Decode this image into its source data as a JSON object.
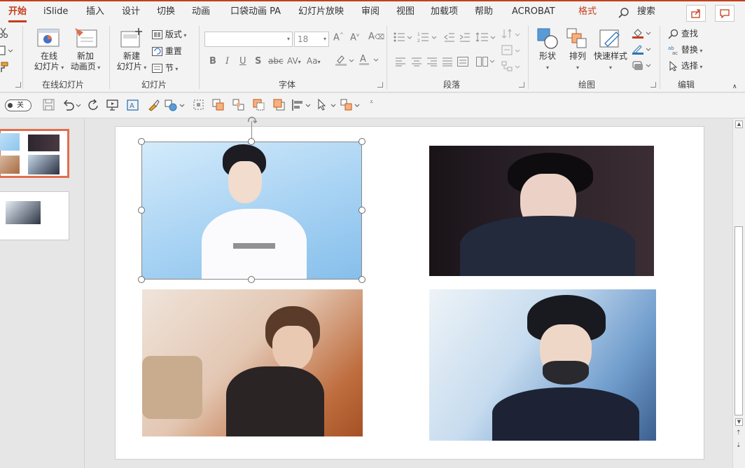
{
  "tabs": [
    {
      "label": "开始",
      "active": true
    },
    {
      "label": "iSlide"
    },
    {
      "label": "插入"
    },
    {
      "label": "设计"
    },
    {
      "label": "切换"
    },
    {
      "label": "动画"
    },
    {
      "label": "口袋动画 PA"
    },
    {
      "label": "幻灯片放映"
    },
    {
      "label": "审阅"
    },
    {
      "label": "视图"
    },
    {
      "label": "加载项"
    },
    {
      "label": "帮助"
    },
    {
      "label": "ACROBAT"
    },
    {
      "label": "格式",
      "format": true
    }
  ],
  "search_label": "搜索",
  "ribbon": {
    "online_slides": {
      "btn1": "在线\n幻灯片",
      "btn2": "新加\n动画页",
      "group": "在线幻灯片"
    },
    "slides": {
      "new_slide": "新建\n幻灯片",
      "layout": "版式",
      "reset": "重置",
      "section": "节",
      "group": "幻灯片"
    },
    "font": {
      "font_name": "",
      "font_size": "18",
      "group": "字体"
    },
    "paragraph": {
      "group": "段落"
    },
    "drawing": {
      "shape": "形状",
      "arrange": "排列",
      "quick_styles": "快速样式",
      "group": "绘图"
    },
    "editing": {
      "find": "查找",
      "replace": "替换",
      "select": "选择",
      "group": "编辑"
    }
  },
  "qat": {
    "toggle_label": "关"
  },
  "slides": [
    {
      "index": 1,
      "selected": true
    },
    {
      "index": 2,
      "selected": false
    }
  ],
  "colors": {
    "accent": "#c43e1c",
    "thumb_selected": "#e06f4e",
    "ribbon_bg": "#f3f3f3",
    "workspace_bg": "#e6e6e6"
  },
  "icons": [
    "cut-icon",
    "paste-icon",
    "format-painter-icon",
    "search-icon",
    "share-icon",
    "comment-icon",
    "save-icon",
    "undo-icon",
    "redo-icon",
    "scroll-up-icon",
    "scroll-down-icon"
  ]
}
